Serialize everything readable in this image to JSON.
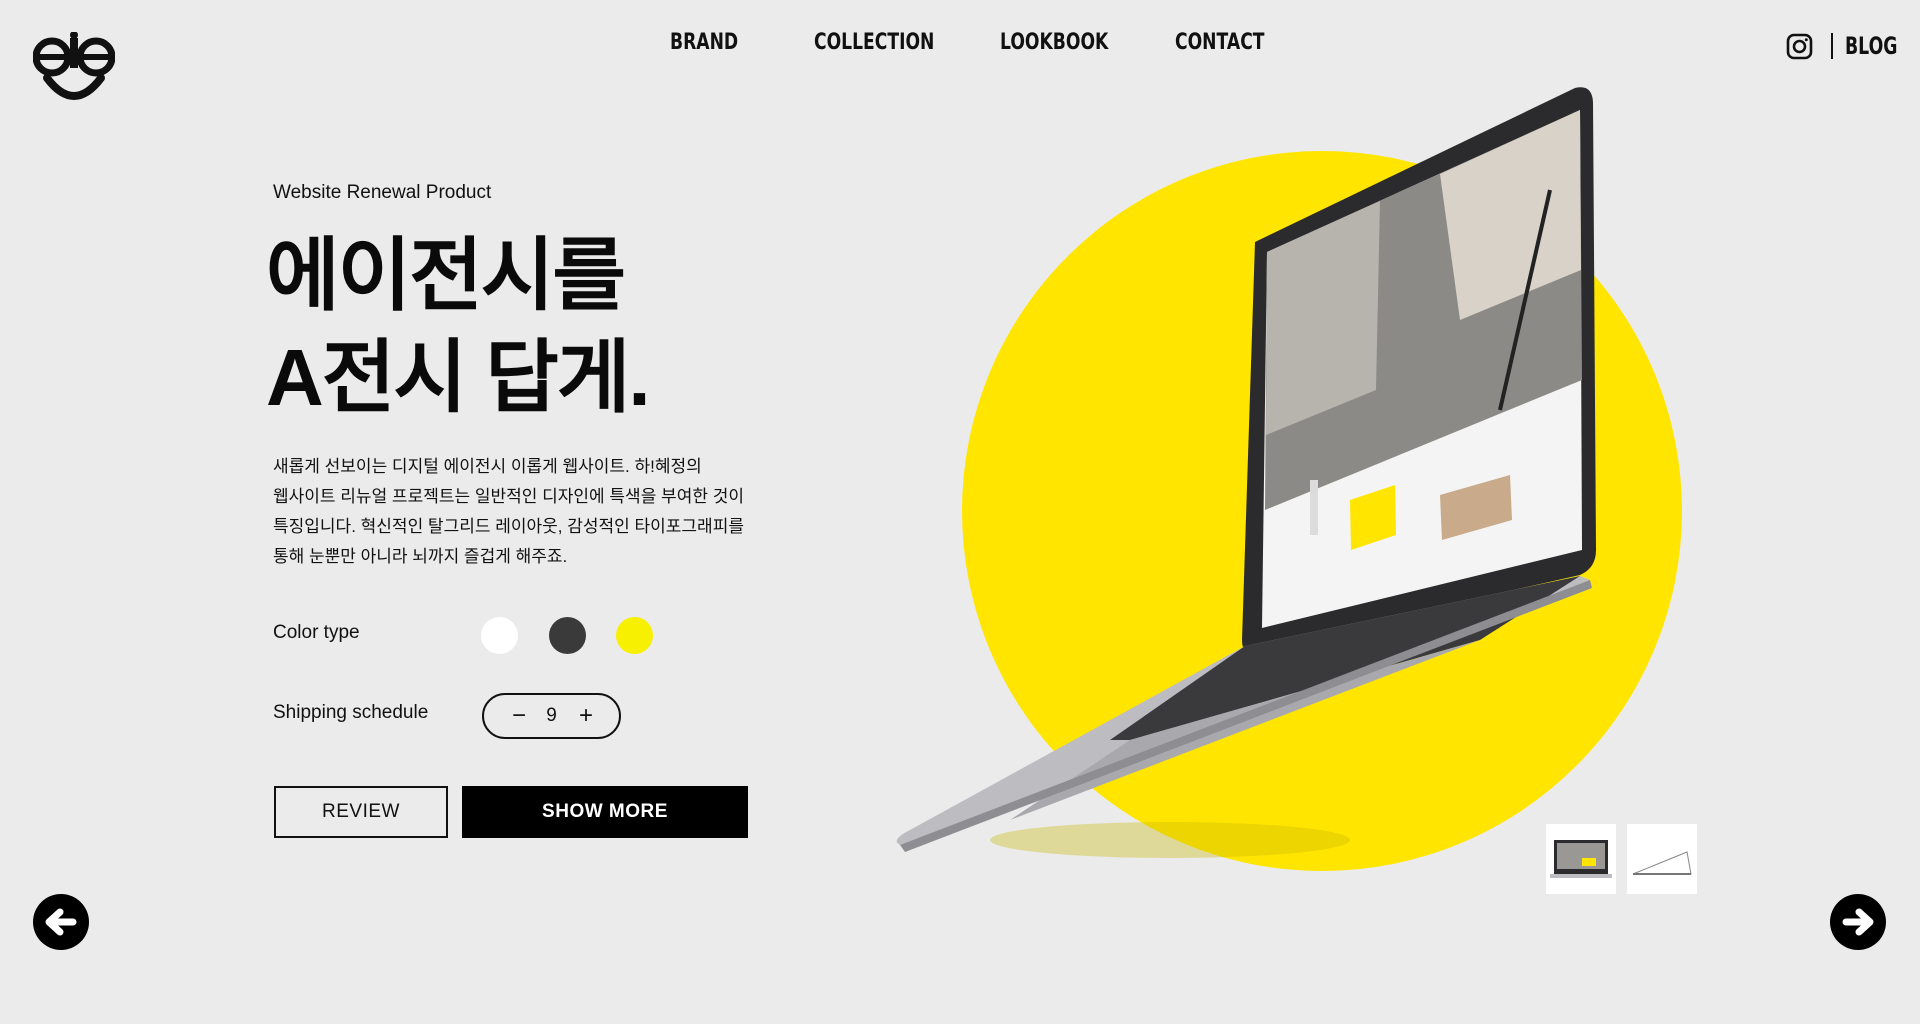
{
  "brand": {
    "logo_name": "eje-logo"
  },
  "nav": {
    "items": [
      {
        "label": "BRAND"
      },
      {
        "label": "COLLECTION"
      },
      {
        "label": "LOOKBOOK"
      },
      {
        "label": "CONTACT"
      }
    ]
  },
  "header_right": {
    "instagram_icon": "instagram-icon",
    "blog_label": "BLOG"
  },
  "hero": {
    "subtitle": "Website Renewal Product",
    "headline_line1": "에이전시를",
    "headline_line2": "A전시 답게.",
    "description": [
      "새롭게 선보이는 디지털 에이전시 이롭게 웹사이트. 하!혜정의",
      "웹사이트 리뉴얼 프로젝트는 일반적인 디자인에 특색을 부여한 것이",
      "특징입니다. 혁신적인 탈그리드 레이아웃, 감성적인 타이포그래피를",
      "통해 눈뿐만 아니라 뇌까지 즐겁게 해주죠."
    ]
  },
  "options": {
    "color_label": "Color type",
    "colors": [
      "#ffffff",
      "#3a3a3a",
      "#f7f000"
    ],
    "shipping_label": "Shipping schedule",
    "quantity": "9",
    "minus_symbol": "−",
    "plus_symbol": "+"
  },
  "buttons": {
    "review": "REVIEW",
    "show_more": "SHOW MORE"
  },
  "accent_color": "#ffe500",
  "slider": {
    "prev_icon": "arrow-left-icon",
    "next_icon": "arrow-right-icon"
  }
}
